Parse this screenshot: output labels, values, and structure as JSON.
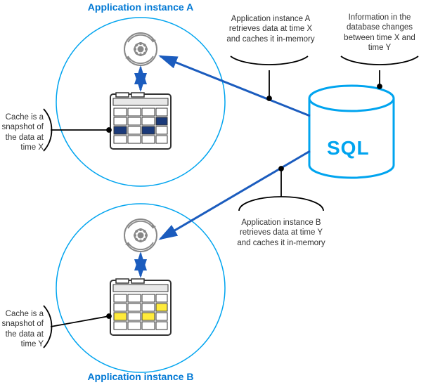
{
  "titles": {
    "instanceA": "Application instance A",
    "instanceB": "Application instance B"
  },
  "labels": {
    "cacheX": "Cache is a snapshot of the data at time X",
    "cacheY": "Cache is a snapshot of the data at time Y",
    "retrieveA": "Application instance A retrieves data at time X and caches it in-memory",
    "retrieveB": "Application instance B retrieves data at time Y and caches it in-memory",
    "dbChanges": "Information in the database changes between time X and time Y",
    "sql": "SQL"
  },
  "chart_data": {
    "type": "diagram",
    "nodes": [
      {
        "id": "instanceA",
        "label": "Application instance A",
        "kind": "app-instance",
        "cache_time": "X",
        "highlight_color": "darkblue"
      },
      {
        "id": "instanceB",
        "label": "Application instance B",
        "kind": "app-instance",
        "cache_time": "Y",
        "highlight_color": "yellow"
      },
      {
        "id": "db",
        "label": "SQL",
        "kind": "database"
      }
    ],
    "edges": [
      {
        "from": "db",
        "to": "instanceA",
        "label": "Application instance A retrieves data at time X and caches it in-memory"
      },
      {
        "from": "db",
        "to": "instanceB",
        "label": "Application instance B retrieves data at time Y and caches it in-memory"
      }
    ],
    "internal_edges": [
      {
        "within": "instanceA",
        "from": "gear-process",
        "to": "data-grid",
        "bidirectional": true
      },
      {
        "within": "instanceB",
        "from": "gear-process",
        "to": "data-grid",
        "bidirectional": true
      }
    ],
    "annotations": [
      {
        "target": "instanceA.grid",
        "text": "Cache is a snapshot of the data at time X"
      },
      {
        "target": "instanceB.grid",
        "text": "Cache is a snapshot of the data at time Y"
      },
      {
        "target": "db",
        "text": "Information in the database changes between time X and time Y"
      }
    ],
    "grid": {
      "rows": 4,
      "cols": 4,
      "highlighted_cells_per_instance": 3
    }
  }
}
